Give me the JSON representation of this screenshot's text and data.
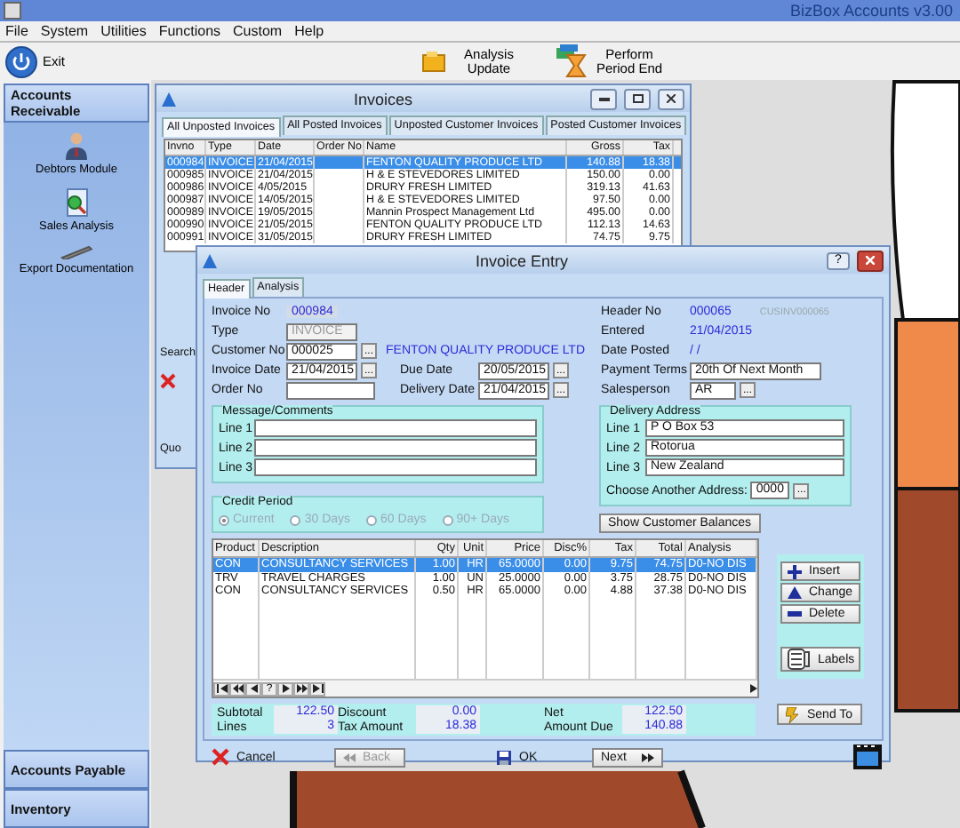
{
  "app": {
    "title": "BizBox Accounts v3.00"
  },
  "menu": [
    "File",
    "System",
    "Utilities",
    "Functions",
    "Custom",
    "Help"
  ],
  "toolbar": [
    {
      "kind": "exit",
      "label": "Exit"
    },
    {
      "kind": "analysis",
      "label": "Analysis Update"
    },
    {
      "kind": "period",
      "label": "Perform Period End"
    }
  ],
  "sidebar": {
    "sections": [
      {
        "label": "Accounts Receivable",
        "expanded": true,
        "items": [
          {
            "kind": "person",
            "label": "Debtors Module"
          },
          {
            "kind": "magnifier",
            "label": "Sales Analysis"
          },
          {
            "kind": "device",
            "label": "Export Documentation"
          }
        ]
      },
      {
        "label": "Accounts Payable",
        "expanded": false
      },
      {
        "label": "Inventory",
        "expanded": false
      }
    ]
  },
  "invoices_window": {
    "title": "Invoices",
    "tabs": [
      {
        "label": "All Unposted Invoices",
        "selected": true
      },
      {
        "label": "All Posted Invoices",
        "selected": false
      },
      {
        "label": "Unposted Customer Invoices",
        "selected": false
      },
      {
        "label": "Posted Customer Invoices",
        "selected": false
      }
    ],
    "columns": [
      "Invno",
      "Type",
      "Date",
      "Order No",
      "Name",
      "Gross",
      "Tax"
    ],
    "rows": [
      {
        "cells": [
          "000984",
          "INVOICE",
          "21/04/2015",
          "",
          "FENTON QUALITY PRODUCE LTD",
          "140.88",
          "18.38"
        ],
        "selected": true
      },
      {
        "cells": [
          "000985",
          "INVOICE",
          "21/04/2015",
          "",
          "H & E STEVEDORES LIMITED",
          "150.00",
          "0.00"
        ],
        "selected": false
      },
      {
        "cells": [
          "000986",
          "INVOICE",
          "4/05/2015",
          "",
          "DRURY FRESH LIMITED",
          "319.13",
          "41.63"
        ],
        "selected": false
      },
      {
        "cells": [
          "000987",
          "INVOICE",
          "14/05/2015",
          "",
          "H & E STEVEDORES LIMITED",
          "97.50",
          "0.00"
        ],
        "selected": false
      },
      {
        "cells": [
          "000989",
          "INVOICE",
          "19/05/2015",
          "",
          "Mannin Prospect Management Ltd",
          "495.00",
          "0.00"
        ],
        "selected": false
      },
      {
        "cells": [
          "000990",
          "INVOICE",
          "21/05/2015",
          "",
          "FENTON QUALITY PRODUCE LTD",
          "112.13",
          "14.63"
        ],
        "selected": false
      },
      {
        "cells": [
          "000991",
          "INVOICE",
          "31/05/2015",
          "",
          "DRURY FRESH LIMITED",
          "74.75",
          "9.75"
        ],
        "selected": false
      }
    ],
    "search_label": "Search",
    "lower_label": "Quo"
  },
  "entry_window": {
    "title": "Invoice Entry",
    "help_button": "?",
    "tabs": [
      {
        "label": "Header",
        "selected": true
      },
      {
        "label": "Analysis",
        "selected": false
      }
    ],
    "left_fields": [
      {
        "label": "Invoice No",
        "kind": "display",
        "value": "000984"
      },
      {
        "label": "Type",
        "kind": "select",
        "value": "INVOICE",
        "disabled": true
      },
      {
        "label": "Customer No",
        "kind": "lookup",
        "value": "000025",
        "button": "...",
        "note": "FENTON QUALITY PRODUCE LTD"
      },
      {
        "label": "Invoice Date",
        "kind": "lookup",
        "value": "21/04/2015",
        "button": "..."
      },
      {
        "label": "Order No",
        "kind": "input"
      }
    ],
    "middle_fields": [
      {
        "label": "Due Date",
        "kind": "lookup",
        "value": "20/05/2015",
        "button": "..."
      },
      {
        "label": "Delivery Date",
        "kind": "lookup",
        "value": "21/04/2015",
        "button": "..."
      }
    ],
    "right_fields": [
      {
        "label": "Header No",
        "kind": "display",
        "value": "000065",
        "note": "CUSINV000065"
      },
      {
        "label": "Entered",
        "kind": "display",
        "value": "21/04/2015"
      },
      {
        "label": "Date Posted",
        "kind": "display",
        "value": " / /"
      },
      {
        "label": "Payment Terms",
        "kind": "input",
        "value": "20th Of Next Month"
      },
      {
        "label": "Salesperson",
        "kind": "lookup",
        "value": "AR",
        "button": "..."
      }
    ],
    "message": {
      "title": "Message/Comments",
      "lines": [
        {
          "label": "Line 1"
        },
        {
          "label": "Line 2"
        },
        {
          "label": "Line 3"
        }
      ]
    },
    "credit_period": {
      "title": "Credit Period",
      "options": [
        {
          "label": "Current",
          "selected": true,
          "disabled": true
        },
        {
          "label": "30 Days",
          "selected": false,
          "disabled": true
        },
        {
          "label": "60 Days",
          "selected": false,
          "disabled": true
        },
        {
          "label": "90+ Days",
          "selected": false,
          "disabled": true
        }
      ]
    },
    "delivery_address": {
      "title": "Delivery Address",
      "lines": [
        {
          "label": "Line 1",
          "value": "P O Box 53"
        },
        {
          "label": "Line 2",
          "value": "Rotorua"
        },
        {
          "label": "Line 3",
          "value": "New Zealand"
        }
      ],
      "choose_label": "Choose Another Address:",
      "choose_value": "0000",
      "choose_button": "..."
    },
    "balances_button": "Show Customer Balances",
    "lines": {
      "columns": [
        "Product",
        "Description",
        "Qty",
        "Unit",
        "Price",
        "Disc%",
        "Tax",
        "Total",
        "Analysis"
      ],
      "rows": [
        {
          "cells": [
            "CON",
            "CONSULTANCY SERVICES",
            "1.00",
            "HR",
            "65.0000",
            "0.00",
            "9.75",
            "74.75",
            "D0-NO DIS"
          ],
          "selected": true
        },
        {
          "cells": [
            "TRV",
            "TRAVEL CHARGES",
            "1.00",
            "UN",
            "25.0000",
            "0.00",
            "3.75",
            "28.75",
            "D0-NO DIS"
          ],
          "selected": false
        },
        {
          "cells": [
            "CON",
            "CONSULTANCY SERVICES",
            "0.50",
            "HR",
            "65.0000",
            "0.00",
            "4.88",
            "37.38",
            "D0-NO DIS"
          ],
          "selected": false
        }
      ],
      "nav": [
        {
          "kind": "first"
        },
        {
          "kind": "prev-page"
        },
        {
          "kind": "prev"
        },
        {
          "kind": "find",
          "label": "?"
        },
        {
          "kind": "next"
        },
        {
          "kind": "next-page"
        },
        {
          "kind": "last"
        }
      ]
    },
    "side_buttons": [
      {
        "kind": "insert",
        "label": "Insert"
      },
      {
        "kind": "change",
        "label": "Change"
      },
      {
        "kind": "delete",
        "label": "Delete"
      },
      {
        "kind": "labels",
        "label": "Labels"
      }
    ],
    "totals": [
      {
        "label": "Subtotal",
        "value": "122.50"
      },
      {
        "label": "Lines",
        "value": "3"
      },
      {
        "label": "Discount",
        "value": "0.00"
      },
      {
        "label": "Tax Amount",
        "value": "18.38"
      },
      {
        "label": "Net",
        "value": "122.50"
      },
      {
        "label": "Amount Due",
        "value": "140.88"
      }
    ],
    "send_button": "Send To",
    "footer_buttons": [
      {
        "kind": "cancel",
        "label": "Cancel",
        "disabled": false
      },
      {
        "kind": "back",
        "label": "Back",
        "disabled": true
      },
      {
        "kind": "ok",
        "label": "OK",
        "disabled": false
      },
      {
        "kind": "next",
        "label": "Next",
        "disabled": false
      }
    ]
  }
}
